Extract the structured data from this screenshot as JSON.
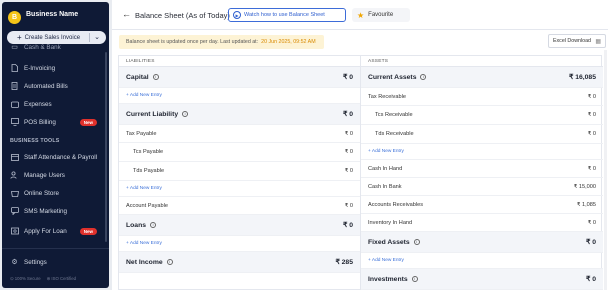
{
  "sidebar": {
    "business_initial": "B",
    "business_name": "Business Name",
    "create_label": "Create Sales Invoice",
    "cut_item": "Cash & Bank",
    "items": [
      {
        "label": "E-Invoicing",
        "icon": "file-icon"
      },
      {
        "label": "Automated Bills",
        "icon": "bill-icon"
      },
      {
        "label": "Expenses",
        "icon": "wallet-icon"
      },
      {
        "label": "POS Billing",
        "icon": "monitor-icon",
        "badge": "New"
      }
    ],
    "section_title": "BUSINESS TOOLS",
    "tools": [
      {
        "label": "Staff Attendance & Payroll",
        "icon": "calendar-icon"
      },
      {
        "label": "Manage Users",
        "icon": "users-icon"
      },
      {
        "label": "Online Store",
        "icon": "store-icon"
      },
      {
        "label": "SMS Marketing",
        "icon": "sms-icon"
      },
      {
        "label": "Apply For Loan",
        "icon": "loan-icon",
        "badge": "New"
      }
    ],
    "settings_label": "Settings",
    "secure_label": "100% Secure",
    "iso_label": "ISO Certified"
  },
  "header": {
    "title": "Balance Sheet (As of Today)",
    "watch_label": "Watch how to use Balance Sheet",
    "favourite_label": "Favourite"
  },
  "notice": {
    "text": "Balance sheet is updated once per day. Last updated at:",
    "timestamp": "20 Jun 2025, 09:52 AM"
  },
  "excel_label": "Excel Download",
  "liabilities": {
    "header": "LIABILITIES",
    "rows": [
      {
        "type": "group",
        "label": "Capital",
        "value": "₹ 0"
      },
      {
        "type": "add",
        "label": "+ Add New Entry"
      },
      {
        "type": "group",
        "label": "Current Liability",
        "value": "₹ 0"
      },
      {
        "type": "item",
        "label": "Tax Payable",
        "value": "₹ 0"
      },
      {
        "type": "sub",
        "label": "Tcs Payable",
        "value": "₹ 0"
      },
      {
        "type": "sub",
        "label": "Tds Payable",
        "value": "₹ 0"
      },
      {
        "type": "add",
        "label": "+ Add New Entry"
      },
      {
        "type": "item",
        "label": "Account Payable",
        "value": "₹ 0"
      },
      {
        "type": "group",
        "label": "Loans",
        "value": "₹ 0"
      },
      {
        "type": "add",
        "label": "+ Add New Entry"
      },
      {
        "type": "group",
        "label": "Net Income",
        "value": "₹ 285"
      }
    ]
  },
  "assets": {
    "header": "ASSETS",
    "rows": [
      {
        "type": "group",
        "label": "Current Assets",
        "value": "₹ 16,085"
      },
      {
        "type": "item",
        "label": "Tax Receivable",
        "value": "₹ 0"
      },
      {
        "type": "sub",
        "label": "Tcs Receivable",
        "value": "₹ 0"
      },
      {
        "type": "sub",
        "label": "Tds Receivable",
        "value": "₹ 0"
      },
      {
        "type": "add",
        "label": "+ Add New Entry"
      },
      {
        "type": "item",
        "label": "Cash In Hand",
        "value": "₹ 0"
      },
      {
        "type": "item",
        "label": "Cash In Bank",
        "value": "₹ 15,000"
      },
      {
        "type": "item",
        "label": "Accounts Receivables",
        "value": "₹ 1,085"
      },
      {
        "type": "item",
        "label": "Inventory In Hand",
        "value": "₹ 0"
      },
      {
        "type": "group",
        "label": "Fixed Assets",
        "value": "₹ 0"
      },
      {
        "type": "add",
        "label": "+ Add New Entry"
      },
      {
        "type": "group",
        "label": "Investments",
        "value": "₹ 0"
      }
    ]
  }
}
